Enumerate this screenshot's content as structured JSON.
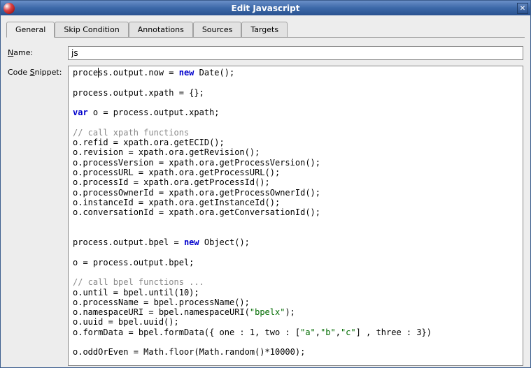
{
  "window": {
    "title": "Edit Javascript"
  },
  "tabs": {
    "items": [
      {
        "label": "General",
        "active": true
      },
      {
        "label": "Skip Condition",
        "active": false
      },
      {
        "label": "Annotations",
        "active": false
      },
      {
        "label": "Sources",
        "active": false
      },
      {
        "label": "Targets",
        "active": false
      }
    ]
  },
  "form": {
    "name_label_pre": "",
    "name_label_ul": "N",
    "name_label_post": "ame:",
    "name_value": "js",
    "snippet_label_pre": "Code ",
    "snippet_label_ul": "S",
    "snippet_label_post": "nippet:"
  },
  "code": {
    "l01a": "proce",
    "l01b": "ss.output.now = ",
    "l01_new": "new",
    "l01c": " Date();",
    "l02": "",
    "l03": "process.output.xpath = {};",
    "l04": "",
    "l05_var": "var",
    "l05b": " o = process.output.xpath;",
    "l06": "",
    "l07_cmt": "// call xpath functions",
    "l08": "o.refid = xpath.ora.getECID();",
    "l09": "o.revision = xpath.ora.getRevision();",
    "l10": "o.processVersion = xpath.ora.getProcessVersion();",
    "l11": "o.processURL = xpath.ora.getProcessURL();",
    "l12": "o.processId = xpath.ora.getProcessId();",
    "l13": "o.processOwnerId = xpath.ora.getProcessOwnerId();",
    "l14": "o.instanceId = xpath.ora.getInstanceId();",
    "l15": "o.conversationId = xpath.ora.getConversationId();",
    "l16": "",
    "l17": "",
    "l18a": "process.output.bpel = ",
    "l18_new": "new",
    "l18b": " Object();",
    "l19": "",
    "l20": "o = process.output.bpel;",
    "l21": "",
    "l22_cmt": "// call bpel functions ...",
    "l23": "o.until = bpel.until(10);",
    "l24": "o.processName = bpel.processName();",
    "l25a": "o.namespaceURI = bpel.namespaceURI(",
    "l25s": "\"bpelx\"",
    "l25b": ");",
    "l26": "o.uuid = bpel.uuid();",
    "l27a": "o.formData = bpel.formData({ one : 1, two : [",
    "l27s1": "\"a\"",
    "l27c1": ",",
    "l27s2": "\"b\"",
    "l27c2": ",",
    "l27s3": "\"c\"",
    "l27b": "] , three : 3})",
    "l28": "",
    "l29": "o.oddOrEven = Math.floor(Math.random()*10000);"
  }
}
